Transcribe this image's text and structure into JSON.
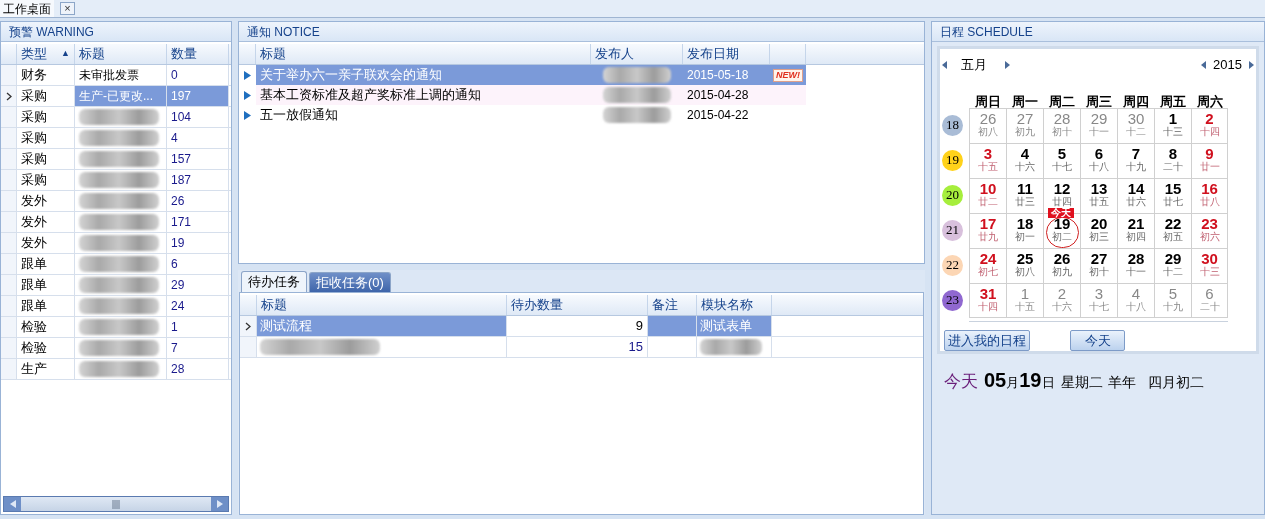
{
  "tab_bar": {
    "tabs": [
      {
        "label": "工作桌面",
        "selected": true,
        "close": "×"
      }
    ]
  },
  "warning": {
    "title": "预警 WARNING",
    "columns": [
      {
        "label": "类型",
        "sort": "▲"
      },
      {
        "label": "标题"
      },
      {
        "label": "数量"
      }
    ],
    "rows": [
      {
        "type": "财务",
        "title": "未审批发票",
        "count": "0",
        "selected": false,
        "redacted": false
      },
      {
        "type": "采购",
        "title": "生产-已更改...",
        "count": "197",
        "selected": true,
        "redacted": false
      },
      {
        "type": "采购",
        "count": "104",
        "selected": false,
        "redacted": true
      },
      {
        "type": "采购",
        "count": "4",
        "selected": false,
        "redacted": true
      },
      {
        "type": "采购",
        "count": "157",
        "selected": false,
        "redacted": true
      },
      {
        "type": "采购",
        "count": "187",
        "selected": false,
        "redacted": true
      },
      {
        "type": "发外",
        "count": "26",
        "selected": false,
        "redacted": true
      },
      {
        "type": "发外",
        "count": "171",
        "selected": false,
        "redacted": true
      },
      {
        "type": "发外",
        "count": "19",
        "selected": false,
        "redacted": true
      },
      {
        "type": "跟单",
        "count": "6",
        "selected": false,
        "redacted": true
      },
      {
        "type": "跟单",
        "count": "29",
        "selected": false,
        "redacted": true
      },
      {
        "type": "跟单",
        "count": "24",
        "selected": false,
        "redacted": true
      },
      {
        "type": "检验",
        "count": "1",
        "selected": false,
        "redacted": true
      },
      {
        "type": "检验",
        "count": "7",
        "selected": false,
        "redacted": true
      },
      {
        "type": "生产",
        "count": "28",
        "selected": false,
        "redacted": true
      }
    ]
  },
  "notice": {
    "title": "通知 NOTICE",
    "columns": [
      "标题",
      "发布人",
      "发布日期"
    ],
    "rows": [
      {
        "title": "关于举办六一亲子联欢会的通知",
        "date": "2015-05-18",
        "badge": "NEW!",
        "selected": true
      },
      {
        "title": "基本工资标准及超产奖标准上调的通知",
        "date": "2015-04-28",
        "selected": false
      },
      {
        "title": "五一放假通知",
        "date": "2015-04-22",
        "selected": false
      }
    ]
  },
  "tasks": {
    "tabs": [
      {
        "label": "待办任务",
        "selected": true
      },
      {
        "label": "拒收任务(0)",
        "selected": false
      }
    ],
    "columns": [
      "标题",
      "待办数量",
      "备注",
      "模块名称"
    ],
    "rows": [
      {
        "title": "测试流程",
        "count": "9",
        "module": "测试表单",
        "selected": true,
        "redacted": false
      },
      {
        "count": "15",
        "selected": false,
        "redacted": true
      }
    ]
  },
  "schedule": {
    "title": "日程 SCHEDULE",
    "month": "五月",
    "year": "2015",
    "weekdays": [
      "周日",
      "周一",
      "周二",
      "周三",
      "周四",
      "周五",
      "周六"
    ],
    "today_badge": "今天",
    "weeks": [
      {
        "week": "18",
        "color": "#a9bcd6",
        "days": [
          {
            "day": "26",
            "lunar": "初八",
            "kind": "other"
          },
          {
            "day": "27",
            "lunar": "初九",
            "kind": "other"
          },
          {
            "day": "28",
            "lunar": "初十",
            "kind": "other"
          },
          {
            "day": "29",
            "lunar": "十一",
            "kind": "other"
          },
          {
            "day": "30",
            "lunar": "十二",
            "kind": "other"
          },
          {
            "day": "1",
            "lunar": "十三",
            "kind": "normal"
          },
          {
            "day": "2",
            "lunar": "十四",
            "kind": "weekend"
          }
        ]
      },
      {
        "week": "19",
        "color": "#ffd21a",
        "days": [
          {
            "day": "3",
            "lunar": "十五",
            "kind": "weekend"
          },
          {
            "day": "4",
            "lunar": "十六",
            "kind": "normal"
          },
          {
            "day": "5",
            "lunar": "十七",
            "kind": "normal"
          },
          {
            "day": "6",
            "lunar": "十八",
            "kind": "normal"
          },
          {
            "day": "7",
            "lunar": "十九",
            "kind": "normal"
          },
          {
            "day": "8",
            "lunar": "二十",
            "kind": "normal"
          },
          {
            "day": "9",
            "lunar": "廿一",
            "kind": "weekend"
          }
        ]
      },
      {
        "week": "20",
        "color": "#a6ee3c",
        "days": [
          {
            "day": "10",
            "lunar": "廿二",
            "kind": "weekend"
          },
          {
            "day": "11",
            "lunar": "廿三",
            "kind": "normal"
          },
          {
            "day": "12",
            "lunar": "廿四",
            "kind": "normal"
          },
          {
            "day": "13",
            "lunar": "廿五",
            "kind": "normal"
          },
          {
            "day": "14",
            "lunar": "廿六",
            "kind": "normal"
          },
          {
            "day": "15",
            "lunar": "廿七",
            "kind": "normal"
          },
          {
            "day": "16",
            "lunar": "廿八",
            "kind": "weekend"
          }
        ]
      },
      {
        "week": "21",
        "color": "#d8c0dc",
        "days": [
          {
            "day": "17",
            "lunar": "廿九",
            "kind": "weekend"
          },
          {
            "day": "18",
            "lunar": "初一",
            "kind": "normal"
          },
          {
            "day": "19",
            "lunar": "初二",
            "kind": "normal",
            "today": true
          },
          {
            "day": "20",
            "lunar": "初三",
            "kind": "normal"
          },
          {
            "day": "21",
            "lunar": "初四",
            "kind": "normal"
          },
          {
            "day": "22",
            "lunar": "初五",
            "kind": "normal"
          },
          {
            "day": "23",
            "lunar": "初六",
            "kind": "weekend"
          }
        ]
      },
      {
        "week": "22",
        "color": "#fcd6b4",
        "days": [
          {
            "day": "24",
            "lunar": "初七",
            "kind": "weekend"
          },
          {
            "day": "25",
            "lunar": "初八",
            "kind": "normal"
          },
          {
            "day": "26",
            "lunar": "初九",
            "kind": "normal"
          },
          {
            "day": "27",
            "lunar": "初十",
            "kind": "normal"
          },
          {
            "day": "28",
            "lunar": "十一",
            "kind": "normal"
          },
          {
            "day": "29",
            "lunar": "十二",
            "kind": "normal"
          },
          {
            "day": "30",
            "lunar": "十三",
            "kind": "weekend"
          }
        ]
      },
      {
        "week": "23",
        "color": "#9068d0",
        "days": [
          {
            "day": "31",
            "lunar": "十四",
            "kind": "weekend"
          },
          {
            "day": "1",
            "lunar": "十五",
            "kind": "other"
          },
          {
            "day": "2",
            "lunar": "十六",
            "kind": "other"
          },
          {
            "day": "3",
            "lunar": "十七",
            "kind": "other"
          },
          {
            "day": "4",
            "lunar": "十八",
            "kind": "other"
          },
          {
            "day": "5",
            "lunar": "十九",
            "kind": "other"
          },
          {
            "day": "6",
            "lunar": "二十",
            "kind": "other"
          }
        ]
      }
    ],
    "buttons": [
      "进入我的日程",
      "今天"
    ],
    "today": {
      "label": "今天",
      "month": "05",
      "month_unit": "月",
      "day": "19",
      "day_unit": "日",
      "weekday": "星期二",
      "year_name": "羊年",
      "lunar_date": "四月初二"
    }
  }
}
